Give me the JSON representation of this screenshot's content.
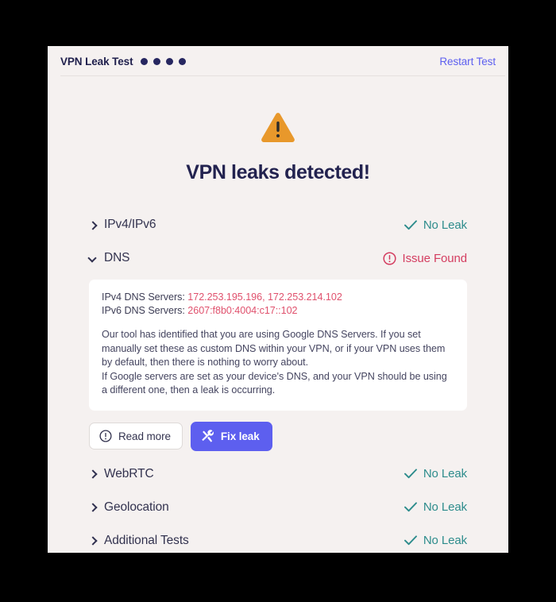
{
  "header": {
    "title": "VPN Leak Test",
    "dots_count": 4,
    "restart_label": "Restart Test",
    "accent_color": "#5d5fef",
    "dot_color": "#262660"
  },
  "hero": {
    "icon": "warning-triangle-icon",
    "icon_color": "#e8982b",
    "title": "VPN leaks detected!"
  },
  "status_labels": {
    "no_leak": "No Leak",
    "issue_found": "Issue Found",
    "ok_color": "#2d8c8c",
    "issue_color": "#d43d60"
  },
  "tests": [
    {
      "id": "ipv4-ipv6",
      "label": "IPv4/IPv6",
      "expanded": false,
      "status": "No Leak",
      "status_kind": "ok"
    },
    {
      "id": "dns",
      "label": "DNS",
      "expanded": true,
      "status": "Issue Found",
      "status_kind": "issue"
    },
    {
      "id": "webrtc",
      "label": "WebRTC",
      "expanded": false,
      "status": "No Leak",
      "status_kind": "ok"
    },
    {
      "id": "geolocation",
      "label": "Geolocation",
      "expanded": false,
      "status": "No Leak",
      "status_kind": "ok"
    },
    {
      "id": "additional-tests",
      "label": "Additional Tests",
      "expanded": false,
      "status": "No Leak",
      "status_kind": "ok"
    }
  ],
  "dns_detail": {
    "ipv4_label": "IPv4 DNS Servers:",
    "ipv4_value": "172.253.195.196, 172.253.214.102",
    "ipv6_label": "IPv6 DNS Servers:",
    "ipv6_value": "2607:f8b0:4004:c17::102",
    "paragraph_1": "Our tool has identified that you are using Google DNS Servers. If you set manually set these as custom DNS within your VPN, or if your VPN uses them by default, then there is nothing to worry about.",
    "paragraph_2": "If Google servers are set as your device's DNS, and your VPN should be using a different one, then a leak is occurring.",
    "value_color": "#e0516d"
  },
  "actions": {
    "read_more_label": "Read more",
    "read_more_icon": "exclamation-circle-icon",
    "fix_leak_label": "Fix leak",
    "fix_leak_icon": "tools-icon",
    "fix_leak_color": "#5d5fef"
  }
}
